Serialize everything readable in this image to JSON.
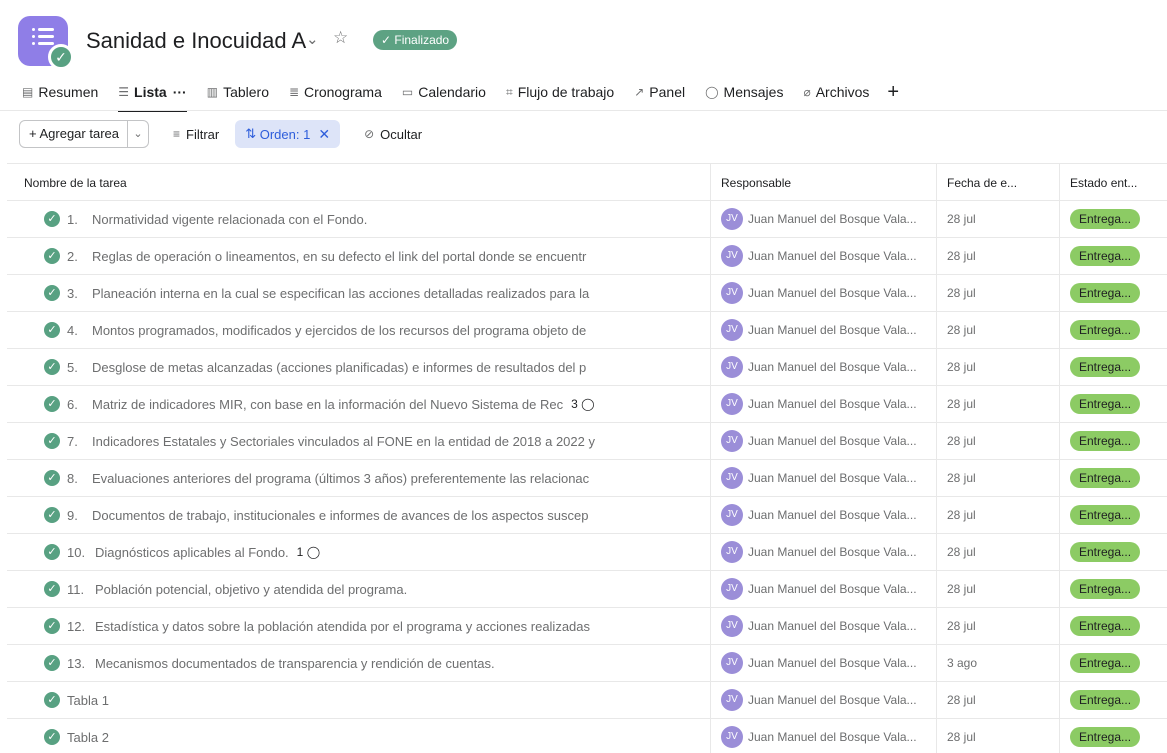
{
  "project": {
    "title": "Sanidad e Inocuidad A",
    "status": "✓ Finalizado",
    "icon": "list-icon",
    "accent_color": "#8f7ee7"
  },
  "tabs": [
    {
      "label": "Resumen",
      "icon": "document-icon"
    },
    {
      "label": "Lista",
      "icon": "list-icon",
      "active": true
    },
    {
      "label": "Tablero",
      "icon": "board-icon"
    },
    {
      "label": "Cronograma",
      "icon": "timeline-icon"
    },
    {
      "label": "Calendario",
      "icon": "calendar-icon"
    },
    {
      "label": "Flujo de trabajo",
      "icon": "workflow-icon"
    },
    {
      "label": "Panel",
      "icon": "chart-icon"
    },
    {
      "label": "Mensajes",
      "icon": "chat-icon"
    },
    {
      "label": "Archivos",
      "icon": "paperclip-icon"
    }
  ],
  "toolbar": {
    "add_task_label": "+ Agregar tarea",
    "filter_label": "Filtrar",
    "sort_label": "Orden: 1",
    "hide_label": "Ocultar"
  },
  "table": {
    "headers": {
      "name": "Nombre de la tarea",
      "assignee": "Responsable",
      "date": "Fecha de e...",
      "status": "Estado ent..."
    },
    "rows": [
      {
        "num": "1.",
        "name": "Normatividad vigente relacionada con el Fondo.",
        "comments": "",
        "assignee": "Juan Manuel del Bosque Vala...",
        "initials": "JV",
        "date": "28 jul",
        "status": "Entrega..."
      },
      {
        "num": "2.",
        "name": "Reglas de operación o lineamentos, en su defecto el link del portal donde se encuentr",
        "comments": "",
        "assignee": "Juan Manuel del Bosque Vala...",
        "initials": "JV",
        "date": "28 jul",
        "status": "Entrega..."
      },
      {
        "num": "3.",
        "name": "Planeación interna en la cual se especifican las acciones detalladas realizados para la",
        "comments": "",
        "assignee": "Juan Manuel del Bosque Vala...",
        "initials": "JV",
        "date": "28 jul",
        "status": "Entrega..."
      },
      {
        "num": "4.",
        "name": "Montos programados, modificados y ejercidos de los recursos del programa objeto de",
        "comments": "",
        "assignee": "Juan Manuel del Bosque Vala...",
        "initials": "JV",
        "date": "28 jul",
        "status": "Entrega..."
      },
      {
        "num": "5.",
        "name": "Desglose de metas alcanzadas (acciones planificadas) e informes de resultados del p",
        "comments": "",
        "assignee": "Juan Manuel del Bosque Vala...",
        "initials": "JV",
        "date": "28 jul",
        "status": "Entrega..."
      },
      {
        "num": "6.",
        "name": "Matriz de indicadores MIR, con base en la información del Nuevo Sistema de Rec",
        "comments": "3",
        "assignee": "Juan Manuel del Bosque Vala...",
        "initials": "JV",
        "date": "28 jul",
        "status": "Entrega..."
      },
      {
        "num": "7.",
        "name": "Indicadores Estatales y Sectoriales vinculados al FONE en la entidad de 2018 a 2022 y",
        "comments": "",
        "assignee": "Juan Manuel del Bosque Vala...",
        "initials": "JV",
        "date": "28 jul",
        "status": "Entrega..."
      },
      {
        "num": "8.",
        "name": "Evaluaciones anteriores del programa (últimos 3 años) preferentemente las relacionac",
        "comments": "",
        "assignee": "Juan Manuel del Bosque Vala...",
        "initials": "JV",
        "date": "28 jul",
        "status": "Entrega..."
      },
      {
        "num": "9.",
        "name": "Documentos de trabajo, institucionales e informes de avances de los aspectos suscep",
        "comments": "",
        "assignee": "Juan Manuel del Bosque Vala...",
        "initials": "JV",
        "date": "28 jul",
        "status": "Entrega..."
      },
      {
        "num": "10.",
        "name": "Diagnósticos aplicables al Fondo.",
        "comments": "1",
        "assignee": "Juan Manuel del Bosque Vala...",
        "initials": "JV",
        "date": "28 jul",
        "status": "Entrega..."
      },
      {
        "num": "11.",
        "name": "Población potencial, objetivo y atendida del programa.",
        "comments": "",
        "assignee": "Juan Manuel del Bosque Vala...",
        "initials": "JV",
        "date": "28 jul",
        "status": "Entrega..."
      },
      {
        "num": "12.",
        "name": "Estadística y datos sobre la población atendida por el programa y acciones realizadas",
        "comments": "",
        "assignee": "Juan Manuel del Bosque Vala...",
        "initials": "JV",
        "date": "28 jul",
        "status": "Entrega..."
      },
      {
        "num": "13.",
        "name": "Mecanismos documentados de transparencia y rendición de cuentas.",
        "comments": "",
        "assignee": "Juan Manuel del Bosque Vala...",
        "initials": "JV",
        "date": "3 ago",
        "status": "Entrega..."
      },
      {
        "num": "",
        "name": "Tabla 1",
        "comments": "",
        "assignee": "Juan Manuel del Bosque Vala...",
        "initials": "JV",
        "date": "28 jul",
        "status": "Entrega..."
      },
      {
        "num": "",
        "name": "Tabla 2",
        "comments": "",
        "assignee": "Juan Manuel del Bosque Vala...",
        "initials": "JV",
        "date": "28 jul",
        "status": "Entrega..."
      }
    ]
  }
}
